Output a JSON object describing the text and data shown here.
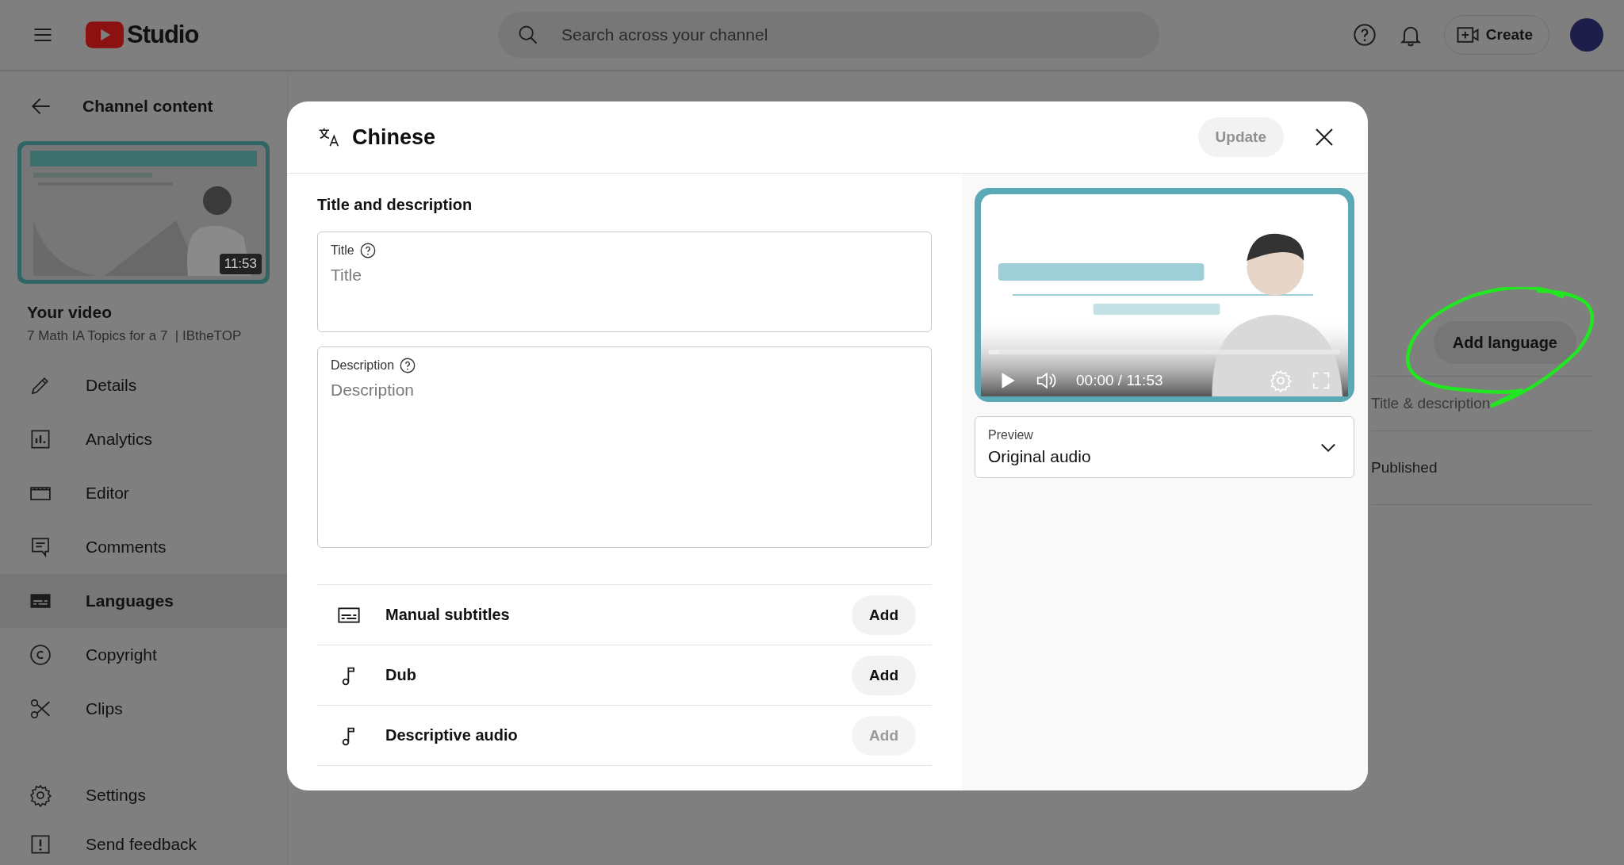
{
  "topbar": {
    "logo_text": "Studio",
    "search": {
      "placeholder": "Search across your channel"
    },
    "create_label": "Create"
  },
  "sidebar": {
    "back_label": "Channel content",
    "thumbnail": {
      "duration": "11:53"
    },
    "video_heading": "Your video",
    "video_title": "7 Math IA Topics for a 7  | IBtheTOP",
    "items": [
      {
        "label": "Details",
        "selected": false
      },
      {
        "label": "Analytics",
        "selected": false
      },
      {
        "label": "Editor",
        "selected": false
      },
      {
        "label": "Comments",
        "selected": false
      },
      {
        "label": "Languages",
        "selected": true
      },
      {
        "label": "Copyright",
        "selected": false
      },
      {
        "label": "Clips",
        "selected": false
      }
    ],
    "footer_items": [
      {
        "label": "Settings"
      },
      {
        "label": "Send feedback"
      }
    ]
  },
  "background": {
    "add_language_button": "Add language",
    "rows": [
      "Title & description",
      "Published"
    ]
  },
  "dialog": {
    "title": "Chinese",
    "update_button": {
      "label": "Update",
      "disabled": true
    },
    "section_heading": "Title and description",
    "fields": [
      {
        "label": "Title",
        "placeholder": "Title",
        "kind": "single"
      },
      {
        "label": "Description",
        "placeholder": "Description",
        "kind": "multi"
      }
    ],
    "tracks": [
      {
        "label": "Manual subtitles",
        "action": "Add",
        "disabled": false
      },
      {
        "label": "Dub",
        "action": "Add",
        "disabled": false
      },
      {
        "label": "Descriptive audio",
        "action": "Add",
        "disabled": true
      }
    ],
    "player": {
      "time": "00:00 / 11:53",
      "level": 0.03
    },
    "preview": {
      "label": "Preview",
      "value": "Original audio"
    }
  }
}
